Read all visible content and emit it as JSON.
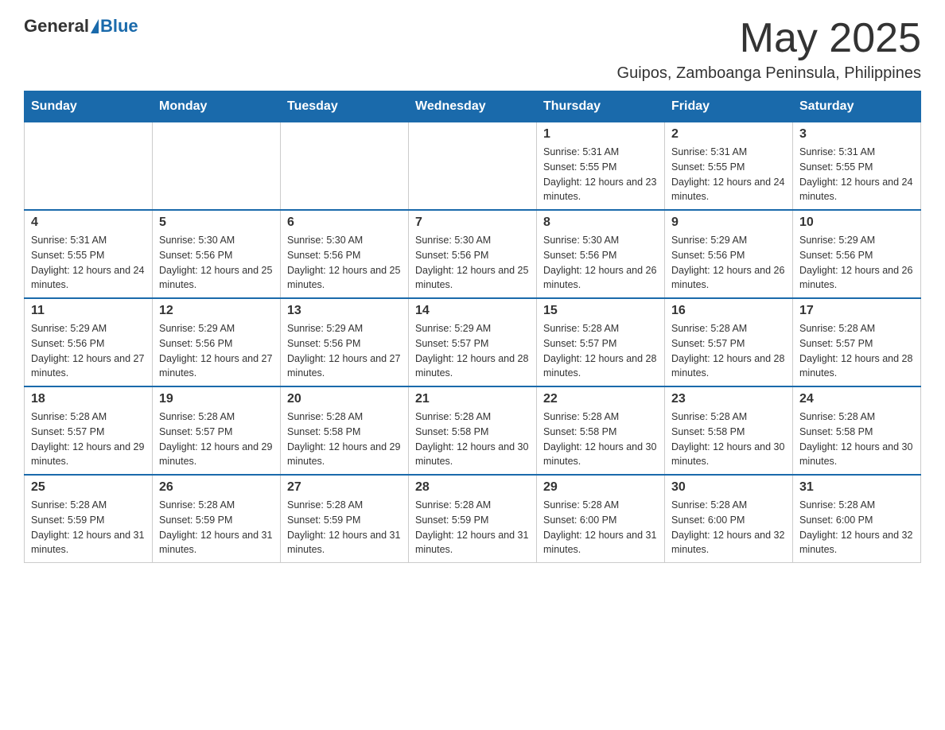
{
  "logo": {
    "general": "General",
    "blue": "Blue"
  },
  "header": {
    "month": "May 2025",
    "location": "Guipos, Zamboanga Peninsula, Philippines"
  },
  "weekdays": [
    "Sunday",
    "Monday",
    "Tuesday",
    "Wednesday",
    "Thursday",
    "Friday",
    "Saturday"
  ],
  "weeks": [
    [
      {
        "day": "",
        "sunrise": "",
        "sunset": "",
        "daylight": ""
      },
      {
        "day": "",
        "sunrise": "",
        "sunset": "",
        "daylight": ""
      },
      {
        "day": "",
        "sunrise": "",
        "sunset": "",
        "daylight": ""
      },
      {
        "day": "",
        "sunrise": "",
        "sunset": "",
        "daylight": ""
      },
      {
        "day": "1",
        "sunrise": "Sunrise: 5:31 AM",
        "sunset": "Sunset: 5:55 PM",
        "daylight": "Daylight: 12 hours and 23 minutes."
      },
      {
        "day": "2",
        "sunrise": "Sunrise: 5:31 AM",
        "sunset": "Sunset: 5:55 PM",
        "daylight": "Daylight: 12 hours and 24 minutes."
      },
      {
        "day": "3",
        "sunrise": "Sunrise: 5:31 AM",
        "sunset": "Sunset: 5:55 PM",
        "daylight": "Daylight: 12 hours and 24 minutes."
      }
    ],
    [
      {
        "day": "4",
        "sunrise": "Sunrise: 5:31 AM",
        "sunset": "Sunset: 5:55 PM",
        "daylight": "Daylight: 12 hours and 24 minutes."
      },
      {
        "day": "5",
        "sunrise": "Sunrise: 5:30 AM",
        "sunset": "Sunset: 5:56 PM",
        "daylight": "Daylight: 12 hours and 25 minutes."
      },
      {
        "day": "6",
        "sunrise": "Sunrise: 5:30 AM",
        "sunset": "Sunset: 5:56 PM",
        "daylight": "Daylight: 12 hours and 25 minutes."
      },
      {
        "day": "7",
        "sunrise": "Sunrise: 5:30 AM",
        "sunset": "Sunset: 5:56 PM",
        "daylight": "Daylight: 12 hours and 25 minutes."
      },
      {
        "day": "8",
        "sunrise": "Sunrise: 5:30 AM",
        "sunset": "Sunset: 5:56 PM",
        "daylight": "Daylight: 12 hours and 26 minutes."
      },
      {
        "day": "9",
        "sunrise": "Sunrise: 5:29 AM",
        "sunset": "Sunset: 5:56 PM",
        "daylight": "Daylight: 12 hours and 26 minutes."
      },
      {
        "day": "10",
        "sunrise": "Sunrise: 5:29 AM",
        "sunset": "Sunset: 5:56 PM",
        "daylight": "Daylight: 12 hours and 26 minutes."
      }
    ],
    [
      {
        "day": "11",
        "sunrise": "Sunrise: 5:29 AM",
        "sunset": "Sunset: 5:56 PM",
        "daylight": "Daylight: 12 hours and 27 minutes."
      },
      {
        "day": "12",
        "sunrise": "Sunrise: 5:29 AM",
        "sunset": "Sunset: 5:56 PM",
        "daylight": "Daylight: 12 hours and 27 minutes."
      },
      {
        "day": "13",
        "sunrise": "Sunrise: 5:29 AM",
        "sunset": "Sunset: 5:56 PM",
        "daylight": "Daylight: 12 hours and 27 minutes."
      },
      {
        "day": "14",
        "sunrise": "Sunrise: 5:29 AM",
        "sunset": "Sunset: 5:57 PM",
        "daylight": "Daylight: 12 hours and 28 minutes."
      },
      {
        "day": "15",
        "sunrise": "Sunrise: 5:28 AM",
        "sunset": "Sunset: 5:57 PM",
        "daylight": "Daylight: 12 hours and 28 minutes."
      },
      {
        "day": "16",
        "sunrise": "Sunrise: 5:28 AM",
        "sunset": "Sunset: 5:57 PM",
        "daylight": "Daylight: 12 hours and 28 minutes."
      },
      {
        "day": "17",
        "sunrise": "Sunrise: 5:28 AM",
        "sunset": "Sunset: 5:57 PM",
        "daylight": "Daylight: 12 hours and 28 minutes."
      }
    ],
    [
      {
        "day": "18",
        "sunrise": "Sunrise: 5:28 AM",
        "sunset": "Sunset: 5:57 PM",
        "daylight": "Daylight: 12 hours and 29 minutes."
      },
      {
        "day": "19",
        "sunrise": "Sunrise: 5:28 AM",
        "sunset": "Sunset: 5:57 PM",
        "daylight": "Daylight: 12 hours and 29 minutes."
      },
      {
        "day": "20",
        "sunrise": "Sunrise: 5:28 AM",
        "sunset": "Sunset: 5:58 PM",
        "daylight": "Daylight: 12 hours and 29 minutes."
      },
      {
        "day": "21",
        "sunrise": "Sunrise: 5:28 AM",
        "sunset": "Sunset: 5:58 PM",
        "daylight": "Daylight: 12 hours and 30 minutes."
      },
      {
        "day": "22",
        "sunrise": "Sunrise: 5:28 AM",
        "sunset": "Sunset: 5:58 PM",
        "daylight": "Daylight: 12 hours and 30 minutes."
      },
      {
        "day": "23",
        "sunrise": "Sunrise: 5:28 AM",
        "sunset": "Sunset: 5:58 PM",
        "daylight": "Daylight: 12 hours and 30 minutes."
      },
      {
        "day": "24",
        "sunrise": "Sunrise: 5:28 AM",
        "sunset": "Sunset: 5:58 PM",
        "daylight": "Daylight: 12 hours and 30 minutes."
      }
    ],
    [
      {
        "day": "25",
        "sunrise": "Sunrise: 5:28 AM",
        "sunset": "Sunset: 5:59 PM",
        "daylight": "Daylight: 12 hours and 31 minutes."
      },
      {
        "day": "26",
        "sunrise": "Sunrise: 5:28 AM",
        "sunset": "Sunset: 5:59 PM",
        "daylight": "Daylight: 12 hours and 31 minutes."
      },
      {
        "day": "27",
        "sunrise": "Sunrise: 5:28 AM",
        "sunset": "Sunset: 5:59 PM",
        "daylight": "Daylight: 12 hours and 31 minutes."
      },
      {
        "day": "28",
        "sunrise": "Sunrise: 5:28 AM",
        "sunset": "Sunset: 5:59 PM",
        "daylight": "Daylight: 12 hours and 31 minutes."
      },
      {
        "day": "29",
        "sunrise": "Sunrise: 5:28 AM",
        "sunset": "Sunset: 6:00 PM",
        "daylight": "Daylight: 12 hours and 31 minutes."
      },
      {
        "day": "30",
        "sunrise": "Sunrise: 5:28 AM",
        "sunset": "Sunset: 6:00 PM",
        "daylight": "Daylight: 12 hours and 32 minutes."
      },
      {
        "day": "31",
        "sunrise": "Sunrise: 5:28 AM",
        "sunset": "Sunset: 6:00 PM",
        "daylight": "Daylight: 12 hours and 32 minutes."
      }
    ]
  ]
}
